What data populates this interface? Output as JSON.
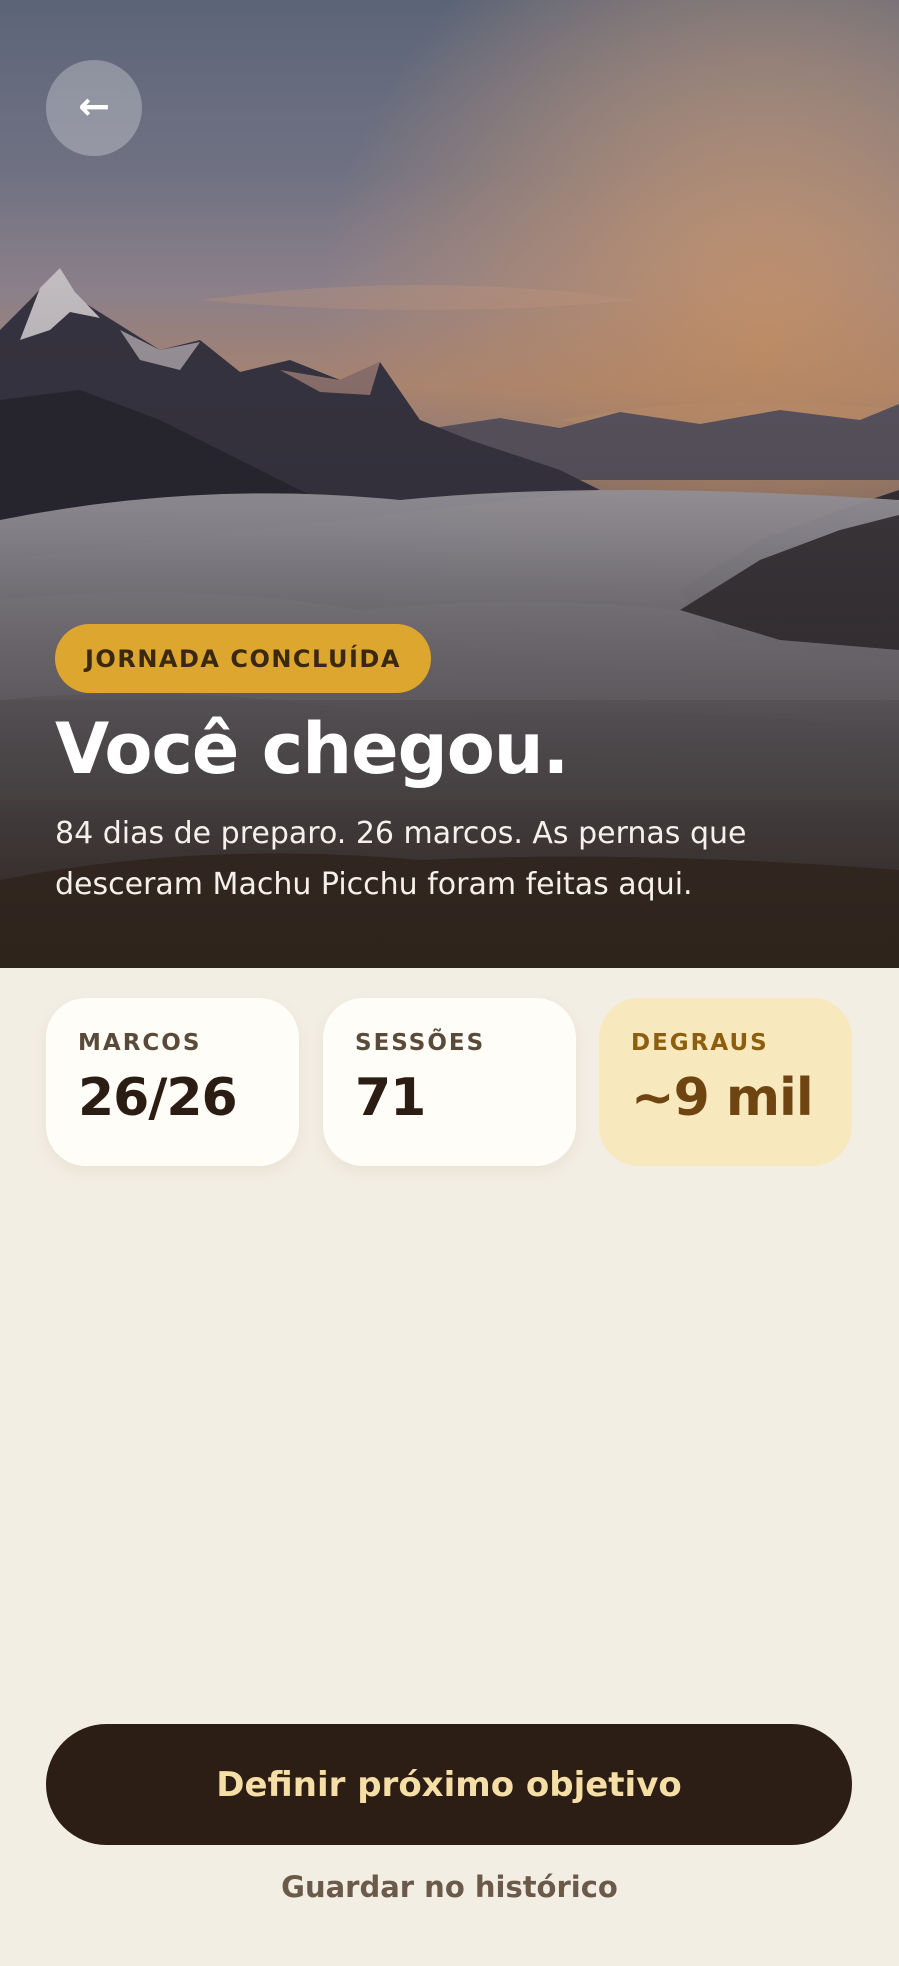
{
  "header": {
    "back_icon": "arrow-left-icon",
    "back_glyph": "←"
  },
  "hero": {
    "badge": "JORNADA CONCLUÍDA",
    "title": "Você chegou.",
    "subtitle": "84 dias de preparo. 26 marcos. As pernas que desceram Machu Picchu foram feitas aqui."
  },
  "stats": [
    {
      "label": "MARCOS",
      "value": "26/26"
    },
    {
      "label": "SESSÕES",
      "value": "71"
    },
    {
      "label": "DEGRAUS",
      "value": "~9 mil"
    }
  ],
  "actions": {
    "primary": "Definir próximo objetivo",
    "secondary": "Guardar no histórico"
  },
  "colors": {
    "background": "#F3EEE3",
    "badge": "#DDA62E",
    "primary_button": "#2C1E14",
    "primary_text": "#F5DFA6",
    "highlight_card": "#F8E8BE"
  }
}
